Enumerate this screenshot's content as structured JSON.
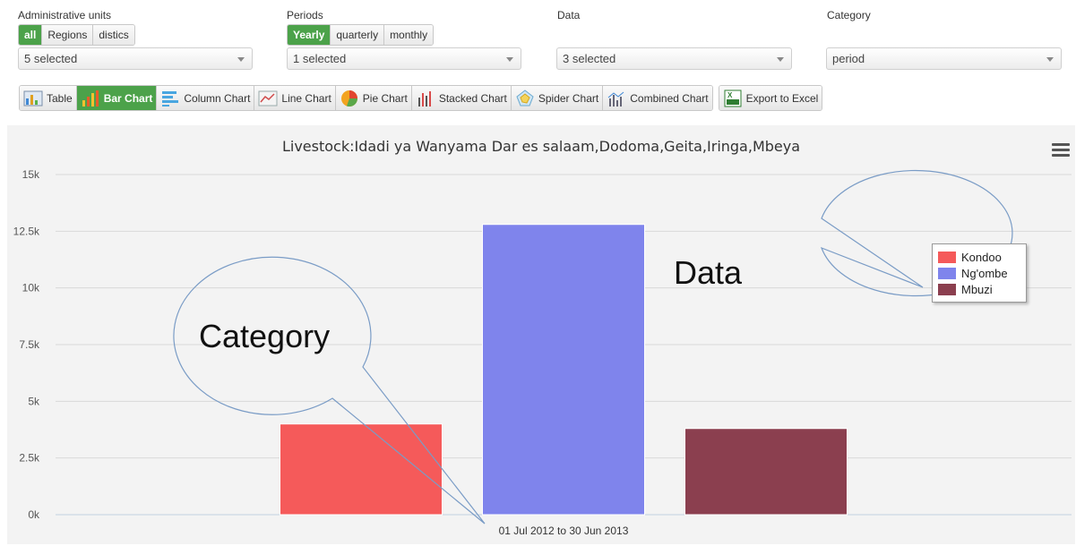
{
  "filters": {
    "admin_units": {
      "label": "Administrative units",
      "options": [
        "all",
        "Regions",
        "distics"
      ],
      "active": 0,
      "selected": "5 selected"
    },
    "periods": {
      "label": "Periods",
      "options": [
        "Yearly",
        "quarterly",
        "monthly"
      ],
      "active": 0,
      "selected": "1 selected"
    },
    "data": {
      "label": "Data",
      "selected": "3 selected"
    },
    "category": {
      "label": "Category",
      "selected": "period"
    }
  },
  "toolbar": {
    "items": [
      {
        "label": "Table",
        "icon": "table-icon"
      },
      {
        "label": "Bar Chart",
        "icon": "bar-chart-icon",
        "active": true
      },
      {
        "label": "Column Chart",
        "icon": "column-chart-icon"
      },
      {
        "label": "Line Chart",
        "icon": "line-chart-icon"
      },
      {
        "label": "Pie Chart",
        "icon": "pie-chart-icon"
      },
      {
        "label": "Stacked Chart",
        "icon": "stacked-chart-icon"
      },
      {
        "label": "Spider Chart",
        "icon": "spider-chart-icon"
      },
      {
        "label": "Combined Chart",
        "icon": "combined-chart-icon"
      }
    ],
    "export_label": "Export to Excel"
  },
  "callouts": {
    "category": "Category",
    "data": "Data"
  },
  "chart_data": {
    "type": "bar",
    "title": "Livestock:Idadi ya Wanyama Dar es salaam,Dodoma,Geita,Iringa,Mbeya",
    "categories": [
      "01 Jul 2012 to 30 Jun 2013"
    ],
    "series": [
      {
        "name": "Kondoo",
        "values": [
          4000
        ],
        "color": "#f55a5a"
      },
      {
        "name": "Ng'ombe",
        "values": [
          12800
        ],
        "color": "#7f84ec"
      },
      {
        "name": "Mbuzi",
        "values": [
          3800
        ],
        "color": "#8b3f4f"
      }
    ],
    "ylim": [
      0,
      15000
    ],
    "yticks": [
      "0k",
      "2.5k",
      "5k",
      "7.5k",
      "10k",
      "12.5k",
      "15k"
    ],
    "grid": true,
    "legend_position": "right"
  }
}
